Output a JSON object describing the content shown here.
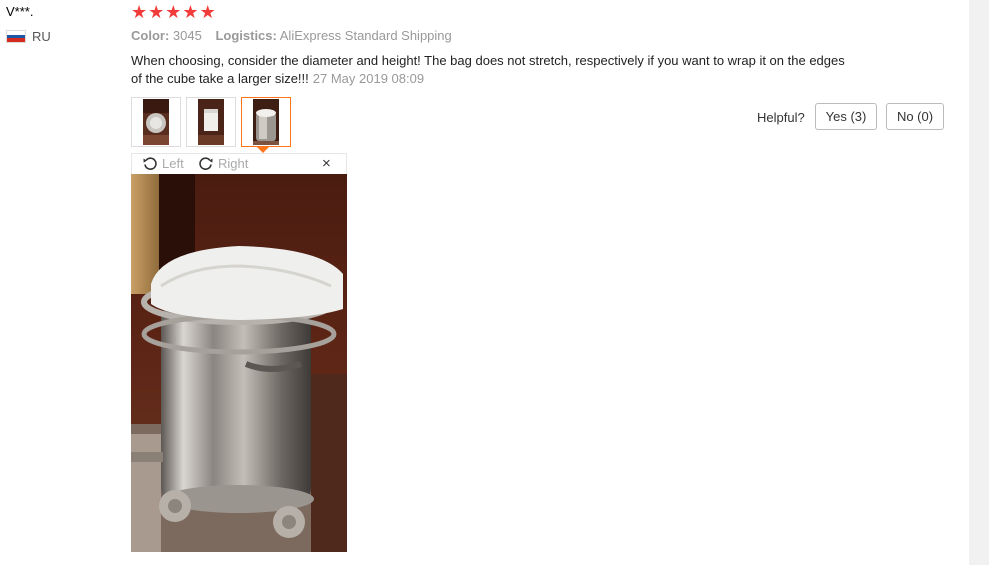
{
  "reviewer": {
    "name": "V***.",
    "country": "RU",
    "flag_colors": [
      "#ffffff",
      "#1c57a5",
      "#d52b1e"
    ]
  },
  "rating": {
    "stars": 5,
    "max": 5,
    "color": "#f23c3c"
  },
  "meta": {
    "color_label": "Color:",
    "color_value": "3045",
    "logistics_label": "Logistics:",
    "logistics_value": "AliExpress Standard Shipping"
  },
  "review": {
    "text": "When choosing, consider the diameter and height! The bag does not stretch, respectively if you want to wrap it on the edges of the cube take a larger size!!!",
    "date": "27 May 2019 08:09"
  },
  "thumbnails": {
    "count": 3,
    "active_index": 2,
    "accent": "#ff7519"
  },
  "helpful": {
    "label": "Helpful?",
    "yes_label": "Yes (3)",
    "no_label": "No (0)"
  },
  "viewer": {
    "rotate_left_label": "Left",
    "rotate_right_label": "Right",
    "close_glyph": "×",
    "icons": [
      "rotate-left-icon",
      "rotate-right-icon",
      "close-icon"
    ]
  }
}
